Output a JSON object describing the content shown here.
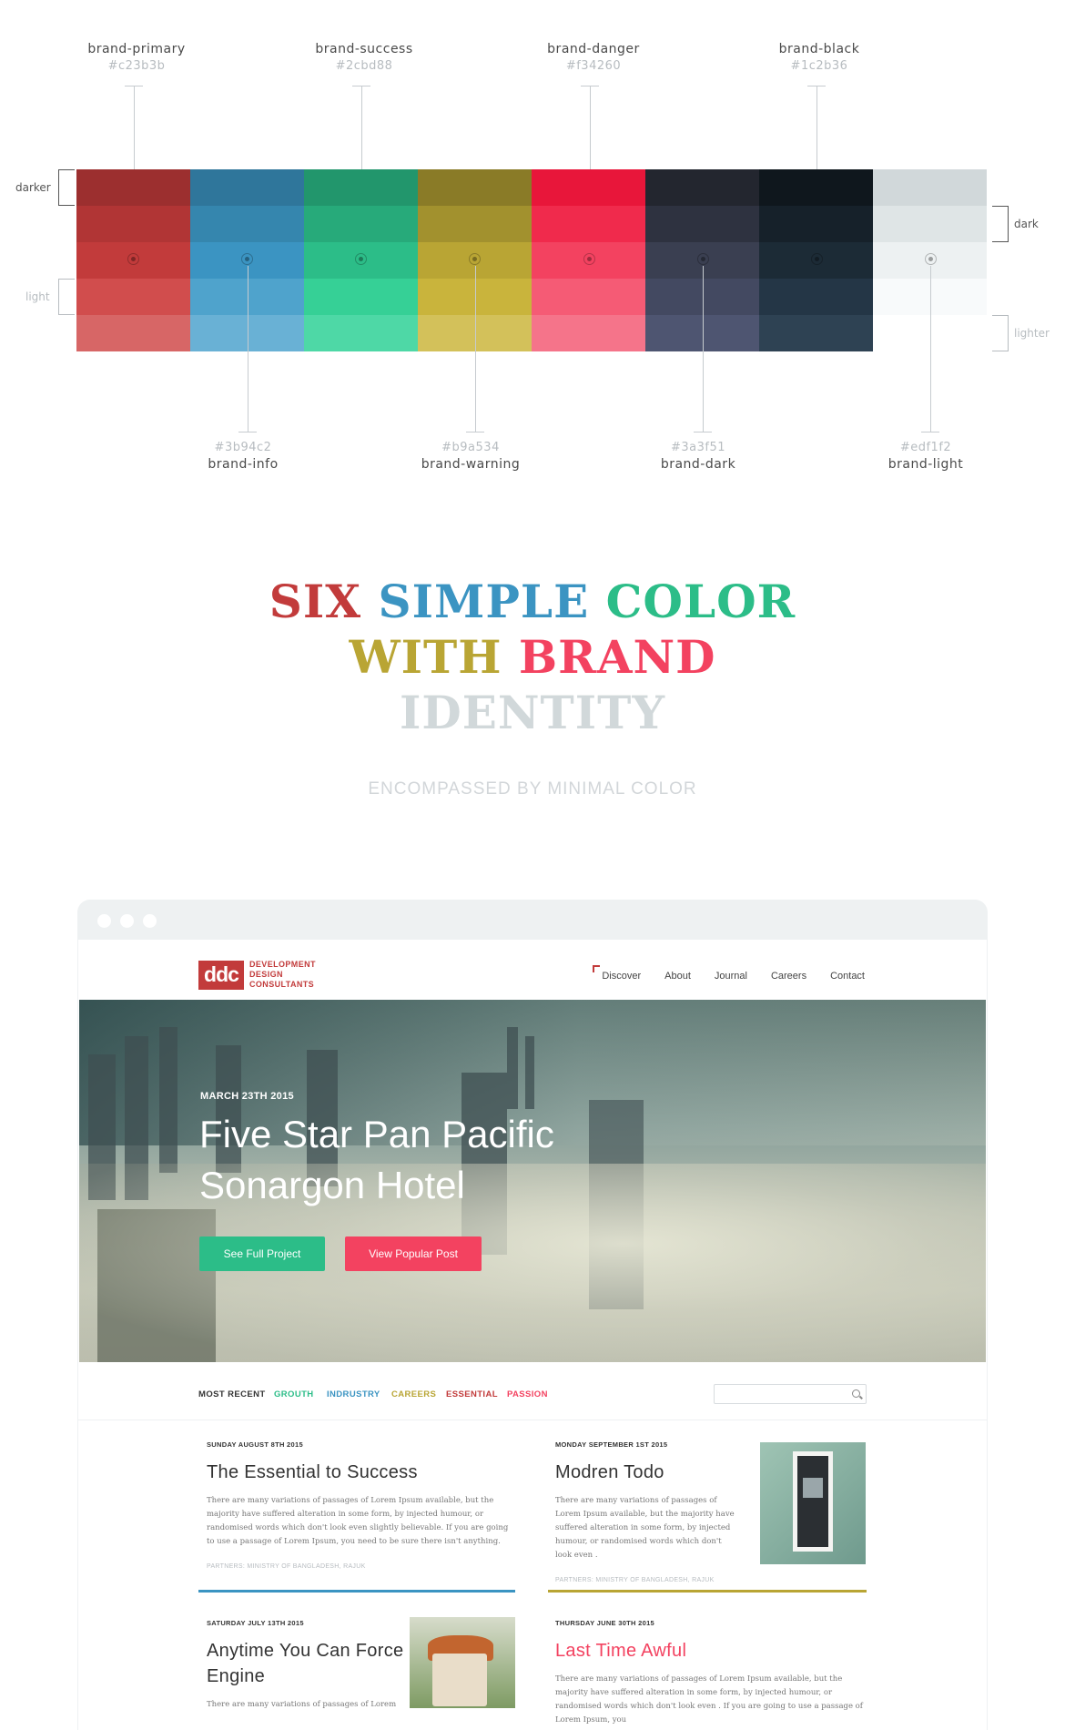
{
  "palette": {
    "top_swatches": [
      {
        "name": "brand-primary",
        "hex": "#c23b3b"
      },
      {
        "name": "brand-success",
        "hex": "#2cbd88"
      },
      {
        "name": "brand-danger",
        "hex": "#f34260"
      },
      {
        "name": "brand-black",
        "hex": "#1c2b36"
      }
    ],
    "bottom_swatches": [
      {
        "name": "brand-info",
        "hex": "#3b94c2"
      },
      {
        "name": "brand-warning",
        "hex": "#b9a534"
      },
      {
        "name": "brand-dark",
        "hex": "#3a3f51"
      },
      {
        "name": "brand-light",
        "hex": "#edf1f2"
      }
    ],
    "side_labels": {
      "darker": "darker",
      "light": "light",
      "dark": "dark",
      "lighter": "lighter"
    },
    "columns": [
      [
        "#9c2f2f",
        "#b13535",
        "#c23b3b",
        "#d14d4d",
        "#d76666"
      ],
      [
        "#2f769b",
        "#3586ae",
        "#3b94c2",
        "#4fa3cc",
        "#69b1d5"
      ],
      [
        "#22966c",
        "#27aa7a",
        "#2cbd88",
        "#36d096",
        "#4ed8a6"
      ],
      [
        "#8a7b27",
        "#a2912e",
        "#b9a534",
        "#c9b43c",
        "#d3c15a"
      ],
      [
        "#e8163a",
        "#f02a4c",
        "#f34260",
        "#f55b75",
        "#f5748a"
      ],
      [
        "#23262f",
        "#2e3240",
        "#3a3f51",
        "#434961",
        "#4e5571"
      ],
      [
        "#0f171d",
        "#16212a",
        "#1c2b36",
        "#243646",
        "#2e4253"
      ],
      [
        "#d1d8da",
        "#dfe5e6",
        "#edf1f2",
        "#f8fafb",
        "#ffffff"
      ]
    ]
  },
  "headline": {
    "words": [
      {
        "text": "SIX",
        "color": "#c23b3b"
      },
      {
        "text": "SIMPLE",
        "color": "#3b94c2"
      },
      {
        "text": "COLOR",
        "color": "#2cbd88"
      },
      {
        "text": "WITH",
        "color": "#b9a534"
      },
      {
        "text": "BRAND",
        "color": "#f34260"
      },
      {
        "text": "IDENTITY",
        "color": "#d1d8da"
      }
    ],
    "subtitle": "ENCOMPASSED BY MINIMAL COLOR"
  },
  "site": {
    "logo": {
      "mark": "ddc",
      "lines": [
        "DEVELOPMENT",
        "DESIGN",
        "CONSULTANTS"
      ]
    },
    "menu": [
      "Discover",
      "About",
      "Journal",
      "Careers",
      "Contact"
    ],
    "hero": {
      "date": "MARCH 23TH 2015",
      "title_line1": "Five Star Pan Pacific",
      "title_line2": "Sonargon Hotel",
      "btn_primary": "See Full Project",
      "btn_secondary": "View Popular Post"
    },
    "tabs": [
      {
        "label": "MOST RECENT",
        "color": "#333333"
      },
      {
        "label": "GROUTH",
        "color": "#2cbd88"
      },
      {
        "label": "INDRUSTRY",
        "color": "#3b94c2"
      },
      {
        "label": "CAREERS",
        "color": "#b9a534"
      },
      {
        "label": "ESSENTIAL",
        "color": "#c23b3b"
      },
      {
        "label": "PASSION",
        "color": "#f34260"
      }
    ],
    "search_placeholder": "",
    "posts": [
      {
        "date": "SUNDAY AUGUST 8TH 2015",
        "title": "The Essential to Success",
        "body": "There are many variations of passages of Lorem Ipsum available, but the majority have suffered alteration in some form, by injected humour, or randomised words which don't look even slightly believable. If you are going to use a passage of Lorem Ipsum, you need to be sure there isn't anything.",
        "partners": "PARTNERS: MINISTRY OF BANGLADESH, RAJUK",
        "rule_color": "#3b94c2"
      },
      {
        "date": "MONDAY SEPTEMBER 1ST 2015",
        "title": "Modren Todo",
        "body": "There are many variations of passages of Lorem Ipsum available, but the majority have suffered alteration in some form, by injected humour, or randomised words which don't look even .",
        "partners": "PARTNERS: MINISTRY OF BANGLADESH, RAJUK",
        "rule_color": "#b9a534"
      },
      {
        "date": "SATURDAY JULY 13TH 2015",
        "title": "Anytime You Can Force Engine",
        "body": "There are many variations of passages of Lorem",
        "partners": "",
        "rule_color": ""
      },
      {
        "date": "THURSDAY JUNE 30TH 2015",
        "title": "Last Time Awful",
        "title_color": "#f34260",
        "body": "There are many variations of passages of Lorem Ipsum available, but the majority have suffered alteration in some form, by injected humour, or randomised words which don't look even . If you are going to use a passage of Lorem Ipsum, you",
        "partners": "",
        "rule_color": ""
      }
    ]
  }
}
